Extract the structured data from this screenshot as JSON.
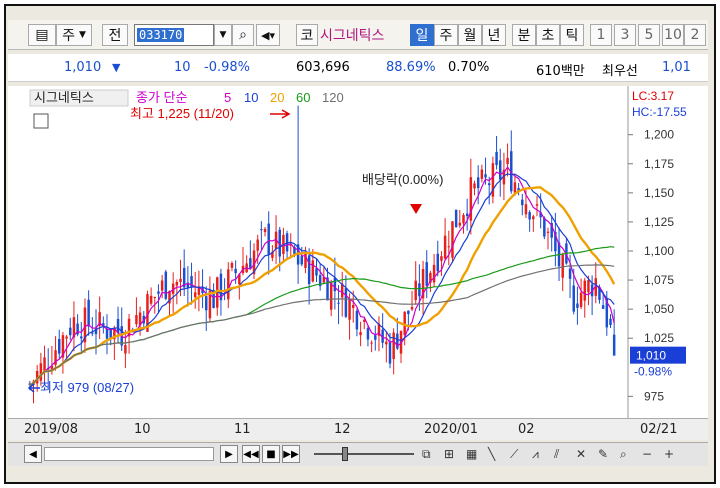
{
  "toolbar": {
    "type_label": "주",
    "jeon_label": "전",
    "code": "033170",
    "kospi": "코",
    "stock_name": "시그네틱스",
    "periods": [
      "일",
      "주",
      "월",
      "년",
      "분",
      "초",
      "틱"
    ],
    "numbers": [
      "1",
      "3",
      "5",
      "10",
      "2"
    ]
  },
  "quote": {
    "price": "1,010",
    "arrow": "▼",
    "change": "10",
    "pct": "-0.98%",
    "volume": "603,696",
    "vol_ratio": "88.69%",
    "turnover": "0.70%",
    "amount": "610백만",
    "pref": "최우선",
    "pref_val": "1,01"
  },
  "legend": {
    "name": "시그네틱스",
    "ma_label": "종가 단순",
    "ma": [
      "5",
      "10",
      "20",
      "60",
      "120"
    ]
  },
  "annotations": {
    "high": "최고 1,225 (11/20)",
    "low": "최저 979 (08/27)",
    "dividend": "배당락(0.00%)",
    "lc": "LC:3.17",
    "hc": "HC:-17.55",
    "cur_price": "1,010",
    "cur_pct": "-0.98%"
  },
  "x_labels": [
    "2019/08",
    "10",
    "11",
    "12",
    "2020/01",
    "02",
    "02/21"
  ],
  "chart_data": {
    "type": "candlestick",
    "y_ticks": [
      "1,200",
      "1,175",
      "1,150",
      "1,125",
      "1,100",
      "1,075",
      "1,050",
      "1,025",
      "975"
    ],
    "ylim": [
      965,
      1235
    ],
    "ma_colors": {
      "5": "#cc00cc",
      "10": "#1a3fd6",
      "20": "#f0a000",
      "60": "#1a9a1a",
      "120": "#707070"
    }
  },
  "colors": {
    "up": "#e8201c",
    "down": "#1a4fd0"
  }
}
